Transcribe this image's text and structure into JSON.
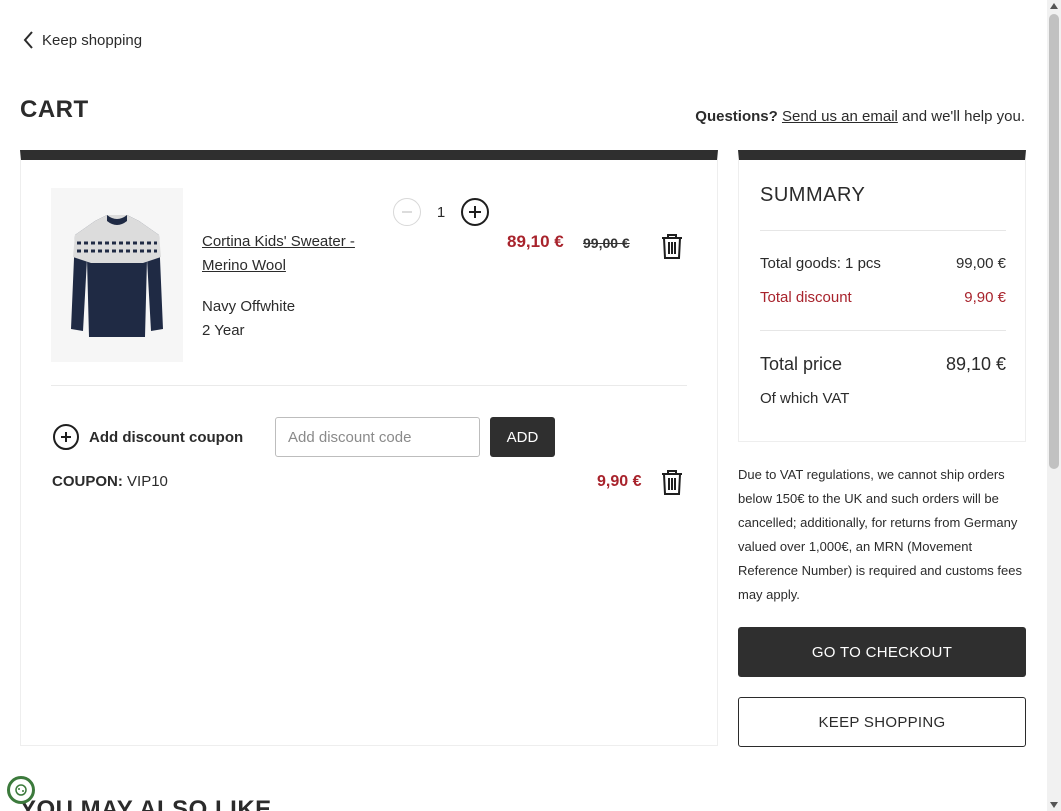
{
  "nav": {
    "back_label": "Keep shopping"
  },
  "page": {
    "title": "CART"
  },
  "help": {
    "prefix": "Questions?",
    "link": "Send us an email",
    "suffix": "and we'll help you."
  },
  "item": {
    "name": "Cortina Kids' Sweater - Merino Wool",
    "color": "Navy Offwhite",
    "size": "2 Year",
    "quantity": "1",
    "price": "89,10 €",
    "original_price": "99,00 €"
  },
  "coupon": {
    "add_label": "Add discount coupon",
    "input_placeholder": "Add discount code",
    "add_button": "ADD",
    "applied_label": "COUPON:",
    "applied_code": "VIP10",
    "applied_amount": "9,90 €"
  },
  "summary": {
    "title": "SUMMARY",
    "goods_label": "Total goods: 1 pcs",
    "goods_value": "99,00 €",
    "discount_label": "Total discount",
    "discount_value": "9,90 €",
    "total_label": "Total price",
    "total_value": "89,10 €",
    "vat_label": "Of which VAT"
  },
  "vat_note": "Due to VAT regulations, we cannot ship orders below 150€ to the UK and such orders will be cancelled; additionally, for returns from Germany valued over 1,000€, an MRN (Movement Reference Number) is required and customs fees may apply.",
  "actions": {
    "checkout": "GO TO CHECKOUT",
    "keep_shopping": "KEEP SHOPPING"
  },
  "recommendations": {
    "title": "YOU MAY ALSO LIKE"
  },
  "colors": {
    "accent": "#a8232c",
    "dark": "#2f2f2f"
  }
}
